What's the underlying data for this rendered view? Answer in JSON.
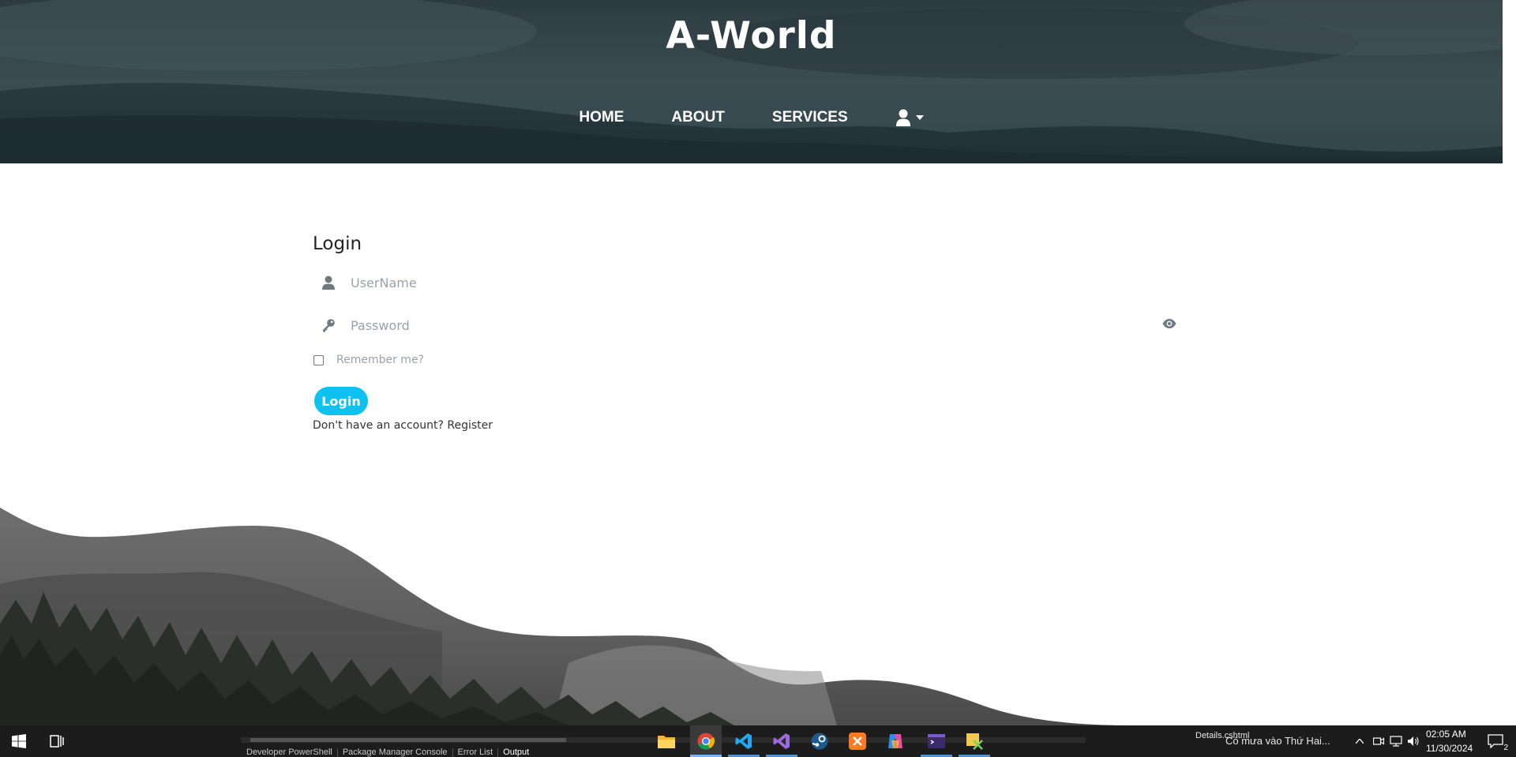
{
  "header": {
    "title": "A-World",
    "nav": [
      {
        "label": "HOME"
      },
      {
        "label": "ABOUT"
      },
      {
        "label": "SERVICES"
      }
    ],
    "user_menu_icon": "user-icon"
  },
  "login": {
    "title": "Login",
    "username_placeholder": "UserName",
    "password_placeholder": "Password",
    "remember_label": "Remember me?",
    "remember_checked": false,
    "button_label": "Login",
    "register_prompt": "Don't have an account?",
    "register_link": "Register"
  },
  "colors": {
    "accent": "#0fc1f0",
    "header_bg": "#34474c"
  },
  "taskbar": {
    "apps": [
      "start-icon",
      "task-view-icon",
      "file-explorer-icon",
      "chrome-icon",
      "vscode-icon",
      "visual-studio-icon",
      "steam-icon",
      "xampp-icon",
      "copilot-icon",
      "terminal-icon",
      "snipping-tool-icon"
    ],
    "vs_tabs": [
      {
        "label": "Developer PowerShell"
      },
      {
        "label": "Package Manager Console"
      },
      {
        "label": "Error List"
      },
      {
        "label": "Output"
      }
    ],
    "open_file": "Details.cshtml",
    "weather": "Có mưa vào Thứ Hai...",
    "time": "02:05 AM",
    "date": "11/30/2024",
    "notifications": "2"
  }
}
